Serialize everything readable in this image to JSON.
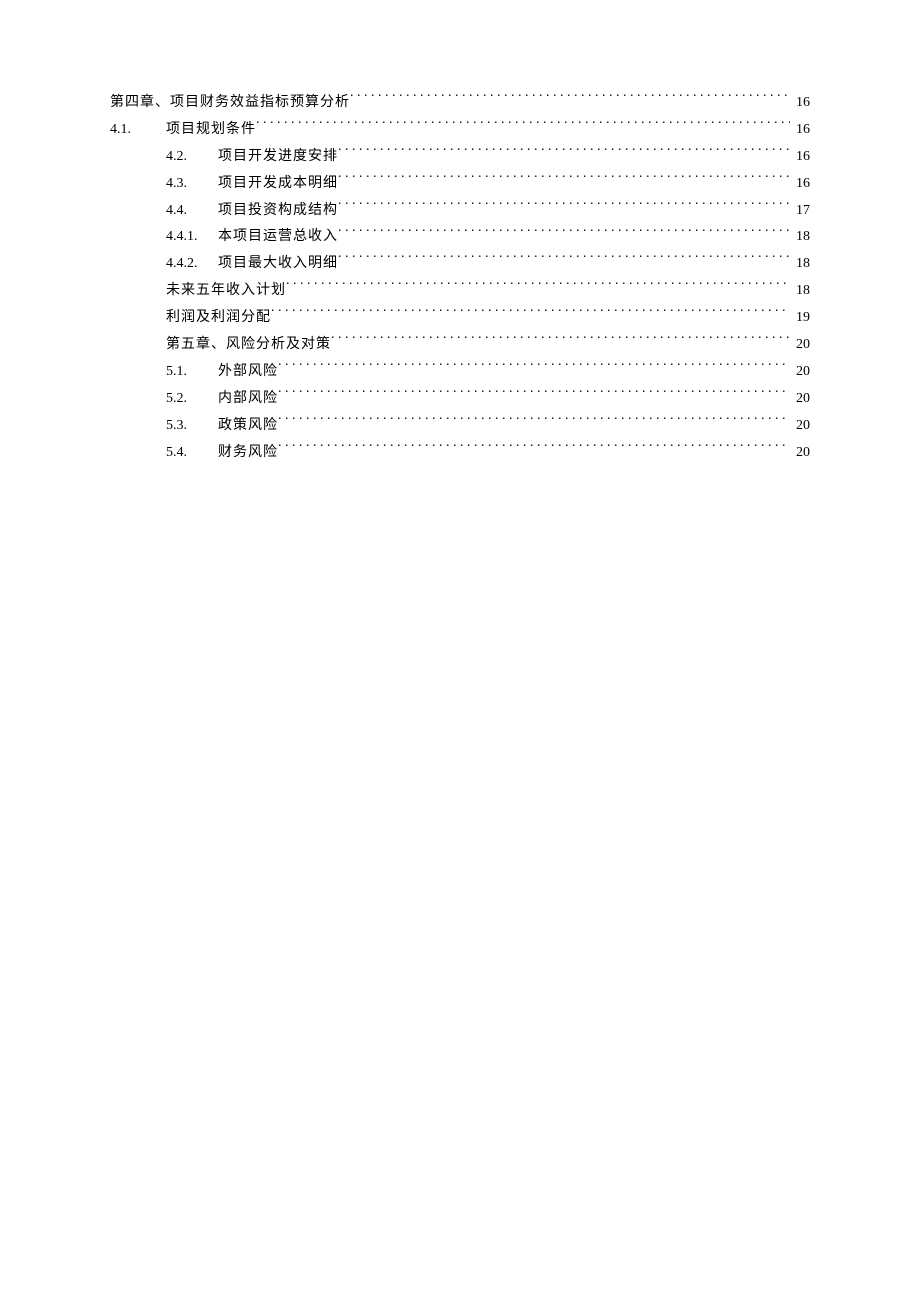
{
  "toc": {
    "row0": {
      "title": "第四章、项目财务效益指标预算分析",
      "page": "16"
    },
    "row1": {
      "num": "4.1.",
      "title": "项目规划条件",
      "page": "16"
    },
    "row2": {
      "num": "4.2.",
      "title": "项目开发进度安排",
      "page": "16"
    },
    "row3": {
      "num": "4.3.",
      "title": "项目开发成本明细",
      "page": "16"
    },
    "row4": {
      "num": "4.4.",
      "title": "项目投资构成结构",
      "page": "17"
    },
    "row5": {
      "num": "4.4.1.",
      "title": "本项目运营总收入",
      "page": "18"
    },
    "row6": {
      "num": "4.4.2.",
      "title": "项目最大收入明细",
      "page": "18"
    },
    "row7": {
      "title": "未来五年收入计划",
      "page": "18"
    },
    "row8": {
      "title": "利润及利润分配",
      "page": "19"
    },
    "row9": {
      "title": "第五章、风险分析及对策",
      "page": "20"
    },
    "row10": {
      "num": "5.1.",
      "title": "外部风险",
      "page": "20"
    },
    "row11": {
      "num": "5.2.",
      "title": "内部风险",
      "page": "20"
    },
    "row12": {
      "num": "5.3.",
      "title": "政策风险",
      "page": "20"
    },
    "row13": {
      "num": "5.4.",
      "title": "财务风险",
      "page": "20"
    }
  }
}
